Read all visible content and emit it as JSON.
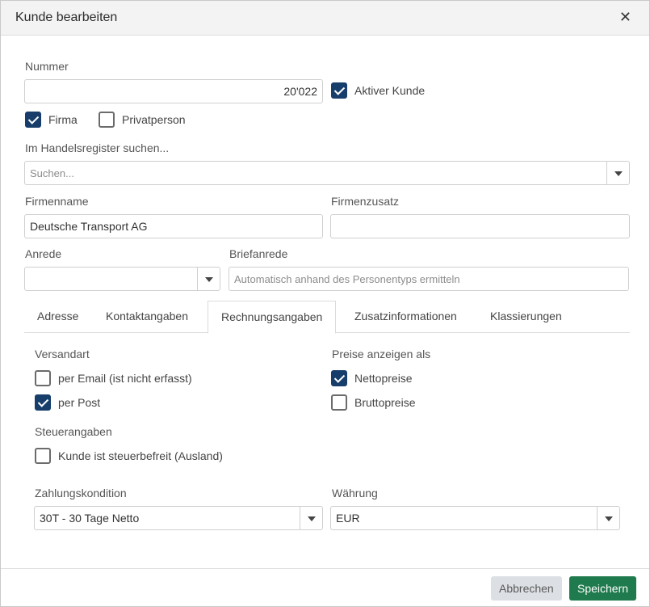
{
  "dialog": {
    "title": "Kunde bearbeiten",
    "close_glyph": "✕"
  },
  "nummer": {
    "label": "Nummer",
    "value": "20'022"
  },
  "aktiv": {
    "label": "Aktiver Kunde",
    "checked": true
  },
  "firma": {
    "label": "Firma",
    "checked": true
  },
  "privat": {
    "label": "Privatperson",
    "checked": false
  },
  "handelsregister": {
    "label": "Im Handelsregister suchen...",
    "placeholder": "Suchen..."
  },
  "firmenname": {
    "label": "Firmenname",
    "value": "Deutsche Transport AG"
  },
  "firmenzusatz": {
    "label": "Firmenzusatz",
    "value": ""
  },
  "anrede": {
    "label": "Anrede",
    "value": ""
  },
  "briefanrede": {
    "label": "Briefanrede",
    "placeholder": "Automatisch anhand des Personentyps ermitteln"
  },
  "tabs": [
    {
      "label": "Adresse",
      "active": false
    },
    {
      "label": "Kontaktangaben",
      "active": false
    },
    {
      "label": "Rechnungsangaben",
      "active": true
    },
    {
      "label": "Zusatzinformationen",
      "active": false
    },
    {
      "label": "Klassierungen",
      "active": false
    }
  ],
  "versandart": {
    "label": "Versandart",
    "email": {
      "label": "per Email (ist nicht erfasst)",
      "checked": false
    },
    "post": {
      "label": "per Post",
      "checked": true
    }
  },
  "preise": {
    "label": "Preise anzeigen als",
    "netto": {
      "label": "Nettopreise",
      "checked": true
    },
    "brutto": {
      "label": "Bruttopreise",
      "checked": false
    }
  },
  "steuer": {
    "label": "Steuerangaben",
    "befreit": {
      "label": "Kunde ist steuerbefreit (Ausland)",
      "checked": false
    }
  },
  "zahlung": {
    "label": "Zahlungskondition",
    "value": "30T - 30 Tage Netto"
  },
  "waehrung": {
    "label": "Währung",
    "value": "EUR"
  },
  "footer": {
    "cancel_label": "Abbrechen",
    "save_label": "Speichern"
  },
  "colors": {
    "accent": "#173e6b",
    "save": "#1f7a4d",
    "cancel": "#dcdfe3"
  }
}
